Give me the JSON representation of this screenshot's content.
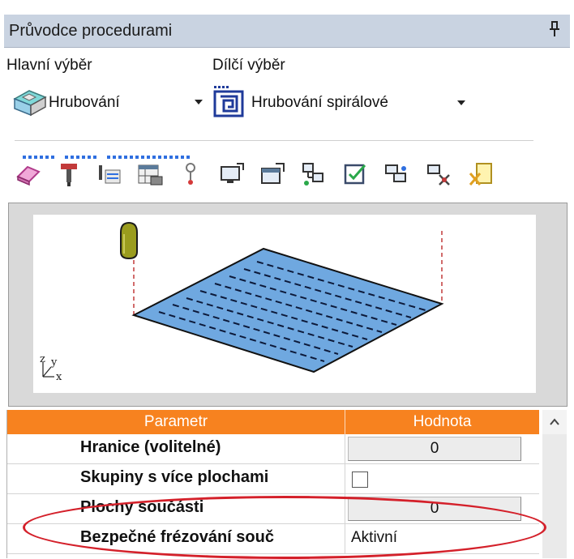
{
  "panel": {
    "title": "Průvodce procedurami",
    "pin_icon": "pin-icon"
  },
  "selection": {
    "main_label": "Hlavní výběr",
    "main_value": "Hrubování",
    "main_icon": "roughing-block-icon",
    "sub_label": "Dílčí výběr",
    "sub_value": "Hrubování spirálové",
    "sub_icon": "spiral-roughing-icon"
  },
  "toolbar": {
    "buttons": [
      "eraser-icon",
      "tool-icon",
      "tool-list-icon",
      "table-grid-icon",
      "probe-icon",
      "monitor-export-icon",
      "window-export-icon",
      "network-icon",
      "checklist-icon",
      "process-icon",
      "settings-icon",
      "clear-icon"
    ],
    "accent": "#2f6fe0"
  },
  "preview": {
    "axis_z": "z",
    "axis_y": "y",
    "axis_x": "x",
    "surface_color": "#6fa8e0",
    "tool_color": "#9a9c1e",
    "path_color": "#c23a3a"
  },
  "table": {
    "header_param": "Parametr",
    "header_value": "Hodnota",
    "header_color": "#f7821f",
    "rows": [
      {
        "name": "Hranice (volitelné)",
        "value": "0"
      },
      {
        "name": "Skupiny s více plochami",
        "value": ""
      },
      {
        "name": "Plochy součásti",
        "value": "0"
      },
      {
        "name": "Bezpečné frézování souč",
        "value": "Aktivní"
      }
    ],
    "highlight_color": "#d4202a"
  }
}
